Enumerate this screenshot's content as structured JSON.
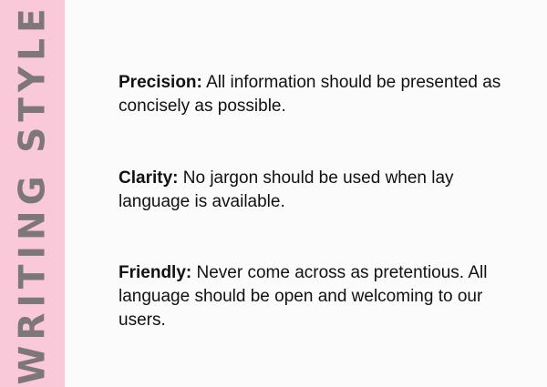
{
  "sidebar": {
    "title": "WRITING STYLE"
  },
  "items": [
    {
      "label": "Precision:",
      "text": " All information should be presented as concisely as possible."
    },
    {
      "label": "Clarity:",
      "text": " No jargon should be used when lay language is available."
    },
    {
      "label": "Friendly:",
      "text": " Never come across as pretentious. All language should be open and welcoming to our users."
    }
  ],
  "colors": {
    "sidebar_background": "#f9c8d9",
    "sidebar_text": "#7e7779",
    "page_background": "#fcfbfc",
    "body_text": "#111111"
  }
}
